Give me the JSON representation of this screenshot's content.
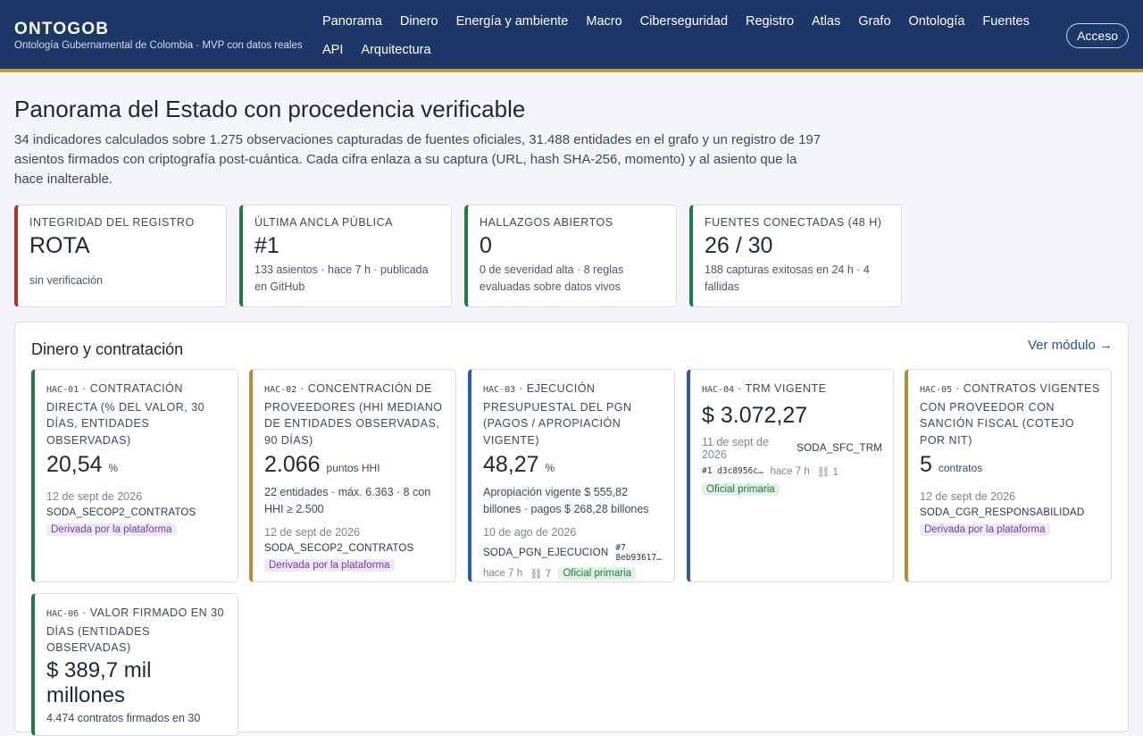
{
  "header": {
    "brand": "ONTOGOB",
    "subtitle": "Ontología Gubernamental de Colombia · MVP con datos reales",
    "nav": [
      "Panorama",
      "Dinero",
      "Energía y ambiente",
      "Macro",
      "Ciberseguridad",
      "Registro",
      "Atlas",
      "Grafo",
      "Ontología",
      "Fuentes",
      "API",
      "Arquitectura"
    ],
    "login": "Acceso"
  },
  "page": {
    "title": "Panorama del Estado con procedencia verificable",
    "intro": "34 indicadores calculados sobre 1.275 observaciones capturadas de fuentes oficiales, 31.488 entidades en el grafo y un registro de 197 asientos firmados con criptografía post-cuántica. Cada cifra enlaza a su captura (URL, hash SHA-256, momento) y al asiento que la hace inalterable."
  },
  "stats": [
    {
      "label": "Integridad del registro",
      "value": "ROTA",
      "note": "sin verificación",
      "status": "error"
    },
    {
      "label": "Última ancla pública",
      "value": "#1",
      "note": "133 asientos · hace 7 h · publicada en GitHub",
      "status": "ok"
    },
    {
      "label": "Hallazgos abiertos",
      "value": "0",
      "note": "0 de severidad alta · 8 reglas evaluadas sobre datos vivos",
      "status": "ok"
    },
    {
      "label": "Fuentes conectadas (48 h)",
      "value": "26 / 30",
      "note": "188 capturas exitosas en 24 h · 4 fallidas",
      "status": "ok"
    }
  ],
  "section": {
    "title": "Dinero y contratación",
    "link": "Ver módulo →"
  },
  "indicators": [
    {
      "code": "HAC-01",
      "label": " · Contratación directa (% del valor, 30 días, entidades observadas)",
      "value": "20,54",
      "unit": "%",
      "date": "12 de sept de 2026",
      "source": "SODA_SECOP2_CONTRATOS",
      "badge": "Derivada por la plataforma"
    },
    {
      "code": "HAC-02",
      "label": " · Concentración de proveedores (HHI mediano de entidades observadas, 90 días)",
      "value": "2.066",
      "unit": "puntos HHI",
      "detail": "22 entidades · máx. 6.363 · 8 con HHI ≥ 2.500",
      "date": "12 de sept de 2026",
      "source": "SODA_SECOP2_CONTRATOS",
      "badge": "Derivada por la plataforma"
    },
    {
      "code": "HAC-03",
      "label": " · Ejecución presupuestal del PGN (pagos / apropiación vigente)",
      "value": "48,27",
      "unit": "%",
      "detail": "Apropiación vigente $ 555,82 billones · pagos $ 268,28 billones",
      "date": "10 de ago de 2026",
      "source": "SODA_PGN_EJECUCION",
      "hash": "#7 8eb93617…",
      "age": "hace 7 h",
      "links": "⛓ 7",
      "badge": "Oficial primaria"
    },
    {
      "code": "HAC-04",
      "label": " · TRM vigente",
      "value": "$ 3.072,27",
      "date": "11 de sept de 2026",
      "source": "SODA_SFC_TRM",
      "hash": "#1 d3c8956c…",
      "age": "hace 7 h",
      "links": "⛓ 1",
      "badge": "Oficial primaria"
    },
    {
      "code": "HAC-05",
      "label": " · Contratos vigentes con proveedor con sanción fiscal (cotejo por NIT)",
      "value": "5",
      "unit": "contratos",
      "date": "12 de sept de 2026",
      "source": "SODA_CGR_RESPONSABILIDAD",
      "badge": "Derivada por la plataforma"
    },
    {
      "code": "HAC-06",
      "label": " · Valor firmado en 30 días (entidades observadas)",
      "value": "$ 389,7 mil millones",
      "detail": "4.474 contratos firmados en 30"
    }
  ],
  "colors": {
    "header_bg": "#1c3768",
    "accent_gold": "#c79a3b",
    "ok_green": "#1f7a45",
    "error_red": "#b42c2c",
    "amber": "#b8892e",
    "blue": "#2a5aa8",
    "link": "#1f4f9a"
  }
}
